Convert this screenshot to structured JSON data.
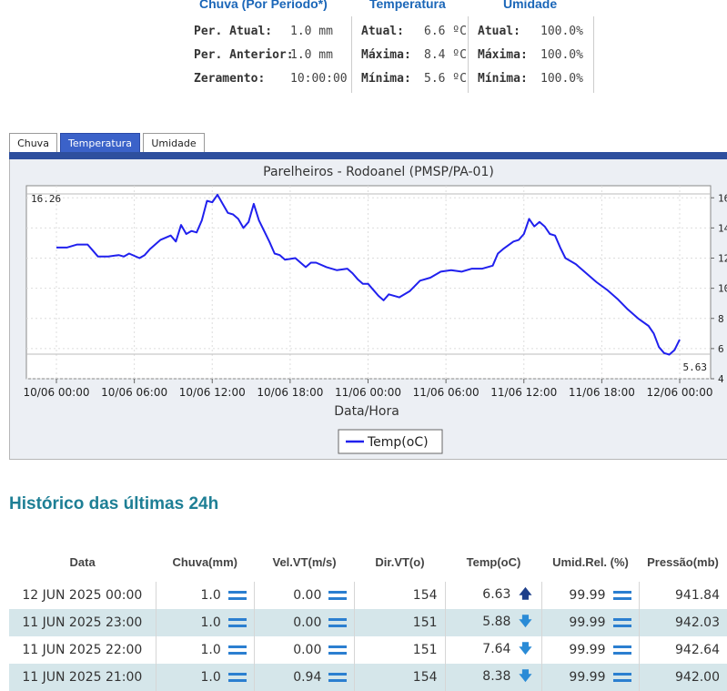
{
  "summary": {
    "chuva": {
      "header": "Chuva (Por Período*)",
      "rows": [
        {
          "label": "Per. Atual:",
          "value": "1.0 mm"
        },
        {
          "label": "Per. Anterior:",
          "value": "1.0 mm"
        },
        {
          "label": "Zeramento:",
          "value": "10:00:00"
        }
      ]
    },
    "temperatura": {
      "header": "Temperatura",
      "rows": [
        {
          "label": "Atual:",
          "value": "6.6 ºC"
        },
        {
          "label": "Máxima:",
          "value": "8.4 ºC"
        },
        {
          "label": "Mínima:",
          "value": "5.6 ºC"
        }
      ]
    },
    "umidade": {
      "header": "Umidade",
      "rows": [
        {
          "label": "Atual:",
          "value": "100.0%"
        },
        {
          "label": "Máxima:",
          "value": "100.0%"
        },
        {
          "label": "Mínima:",
          "value": "100.0%"
        }
      ]
    }
  },
  "tabs": [
    {
      "label": "Chuva",
      "active": false
    },
    {
      "label": "Temperatura",
      "active": true
    },
    {
      "label": "Umidade",
      "active": false
    }
  ],
  "chart_data": {
    "type": "line",
    "title": "Parelheiros - Rodoanel (PMSP/PA-01)",
    "xlabel": "Data/Hora",
    "ylabel": "",
    "x_ticks": [
      "10/06 00:00",
      "10/06 06:00",
      "10/06 12:00",
      "10/06 18:00",
      "11/06 00:00",
      "11/06 06:00",
      "11/06 12:00",
      "11/06 18:00",
      "12/06 00:00"
    ],
    "x_range_hours": [
      -1,
      49
    ],
    "ylim": [
      4,
      16.8
    ],
    "y_ticks_visible": [
      "16",
      "14",
      "12",
      "10",
      "8",
      "6",
      "4"
    ],
    "max_annotation": "16.26",
    "min_annotation": "5.63",
    "legend": {
      "label": "Temp(oC)",
      "placement": "bottom-center"
    },
    "grid": true,
    "line_color": "#2020ee",
    "series": [
      {
        "name": "Temp(oC)",
        "points": [
          [
            0,
            12.7
          ],
          [
            1,
            12.7
          ],
          [
            2,
            12.9
          ],
          [
            3,
            12.9
          ],
          [
            3.5,
            12.5
          ],
          [
            4,
            12.1
          ],
          [
            5,
            12.1
          ],
          [
            6,
            12.2
          ],
          [
            6.5,
            12.1
          ],
          [
            7,
            12.3
          ],
          [
            8,
            12.0
          ],
          [
            8.5,
            12.2
          ],
          [
            9,
            12.6
          ],
          [
            10,
            13.2
          ],
          [
            11,
            13.5
          ],
          [
            11.5,
            13.1
          ],
          [
            12,
            14.2
          ],
          [
            12.5,
            13.6
          ],
          [
            13,
            13.8
          ],
          [
            13.5,
            13.7
          ],
          [
            14,
            14.5
          ],
          [
            14.5,
            15.8
          ],
          [
            15,
            15.7
          ],
          [
            15.5,
            16.2
          ],
          [
            16,
            15.6
          ],
          [
            16.5,
            15.0
          ],
          [
            17,
            14.9
          ],
          [
            17.5,
            14.6
          ],
          [
            18,
            14.0
          ],
          [
            18.5,
            14.4
          ],
          [
            19,
            15.6
          ],
          [
            19.5,
            14.5
          ],
          [
            20,
            13.8
          ],
          [
            20.5,
            13.1
          ],
          [
            21,
            12.3
          ],
          [
            21.5,
            12.2
          ],
          [
            22,
            11.9
          ],
          [
            23,
            12.0
          ],
          [
            23.5,
            11.7
          ],
          [
            24,
            11.4
          ],
          [
            24.5,
            11.7
          ],
          [
            25,
            11.7
          ],
          [
            26,
            11.4
          ],
          [
            27,
            11.2
          ],
          [
            28,
            11.3
          ],
          [
            28.5,
            11.0
          ],
          [
            29,
            10.6
          ],
          [
            29.5,
            10.3
          ],
          [
            30,
            10.3
          ],
          [
            30.5,
            9.9
          ],
          [
            31,
            9.5
          ],
          [
            31.5,
            9.2
          ],
          [
            32,
            9.6
          ],
          [
            33,
            9.4
          ],
          [
            34,
            9.8
          ],
          [
            35,
            10.5
          ],
          [
            36,
            10.7
          ],
          [
            37,
            11.1
          ],
          [
            38,
            11.2
          ],
          [
            39,
            11.1
          ],
          [
            40,
            11.3
          ],
          [
            41,
            11.3
          ],
          [
            42,
            11.5
          ],
          [
            42.5,
            12.3
          ],
          [
            43,
            12.6
          ],
          [
            44,
            13.1
          ],
          [
            44.5,
            13.2
          ],
          [
            45,
            13.6
          ],
          [
            45.5,
            14.6
          ],
          [
            46,
            14.1
          ],
          [
            46.5,
            14.4
          ],
          [
            47,
            14.1
          ],
          [
            47.5,
            13.6
          ],
          [
            48,
            13.5
          ],
          [
            48.5,
            12.7
          ],
          [
            49,
            12.0
          ],
          [
            50,
            11.6
          ],
          [
            51,
            11.0
          ],
          [
            52,
            10.4
          ],
          [
            53,
            9.9
          ],
          [
            54,
            9.3
          ],
          [
            55,
            8.6
          ],
          [
            56,
            8.0
          ],
          [
            57,
            7.5
          ],
          [
            57.5,
            7.0
          ],
          [
            58,
            6.1
          ],
          [
            58.5,
            5.7
          ],
          [
            59,
            5.6
          ],
          [
            59.5,
            5.9
          ],
          [
            60,
            6.6
          ]
        ]
      }
    ]
  },
  "history": {
    "title": "Histórico das últimas 24h",
    "columns": [
      "Data",
      "Chuva(mm)",
      "Vel.VT(m/s)",
      "Dir.VT(o)",
      "Temp(oC)",
      "Umid.Rel. (%)",
      "Pressão(mb)"
    ],
    "rows": [
      {
        "data": "12 JUN 2025 00:00",
        "chuva": "1.0",
        "vel": "0.00",
        "dir": "154",
        "temp": "6.63",
        "temp_trend": "up",
        "umid": "99.99",
        "pressao": "941.84"
      },
      {
        "data": "11 JUN 2025 23:00",
        "chuva": "1.0",
        "vel": "0.00",
        "dir": "151",
        "temp": "5.88",
        "temp_trend": "down",
        "umid": "99.99",
        "pressao": "942.03"
      },
      {
        "data": "11 JUN 2025 22:00",
        "chuva": "1.0",
        "vel": "0.00",
        "dir": "151",
        "temp": "7.64",
        "temp_trend": "down",
        "umid": "99.99",
        "pressao": "942.64"
      },
      {
        "data": "11 JUN 2025 21:00",
        "chuva": "1.0",
        "vel": "0.94",
        "dir": "154",
        "temp": "8.38",
        "temp_trend": "down",
        "umid": "99.99",
        "pressao": "942.00"
      }
    ]
  }
}
